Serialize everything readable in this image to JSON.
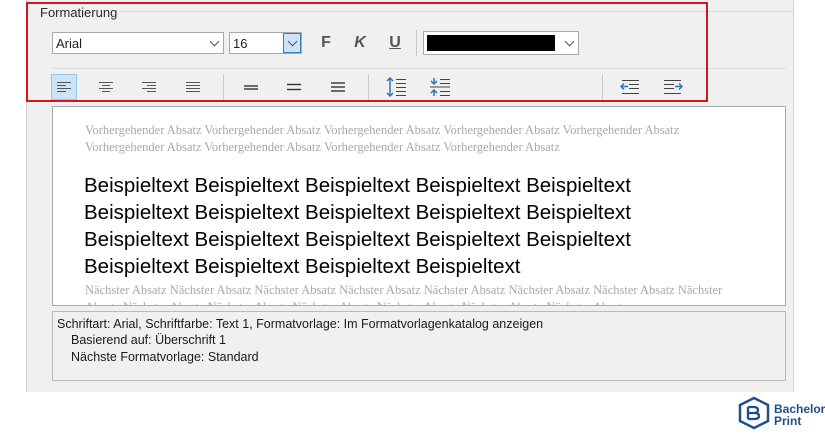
{
  "group": {
    "label": "Formatierung"
  },
  "font": {
    "name": "Arial",
    "size": "16"
  },
  "format_buttons": {
    "bold": "F",
    "italic": "K",
    "underline": "U"
  },
  "color": {
    "value": "#000000"
  },
  "preview": {
    "previous_paragraph": "Vorhergehender Absatz Vorhergehender Absatz Vorhergehender Absatz Vorhergehender Absatz Vorhergehender Absatz Vorhergehender Absatz Vorhergehender Absatz Vorhergehender Absatz Vorhergehender Absatz",
    "sample_lines": [
      "Beispieltext Beispieltext Beispieltext Beispieltext Beispieltext",
      "Beispieltext Beispieltext Beispieltext Beispieltext Beispieltext",
      "Beispieltext Beispieltext Beispieltext Beispieltext Beispieltext",
      "Beispieltext Beispieltext Beispieltext Beispieltext"
    ],
    "next_paragraph": "Nächster Absatz Nächster Absatz Nächster Absatz Nächster Absatz Nächster Absatz Nächster Absatz Nächster Absatz Nächster Absatz Nächster Absatz Nächster Absatz Nächster Absatz Nächster Absatz Nächster Absatz Nächster Absatz"
  },
  "description": {
    "line1": "Schriftart: Arial, Schriftfarbe: Text 1, Formatvorlage: Im Formatvorlagenkatalog anzeigen",
    "line2": "Basierend auf: Überschrift 1",
    "line3": "Nächste Formatvorlage: Standard"
  },
  "brand": {
    "line1": "Bachelor",
    "line2": "Print",
    "color": "#1f4e8c"
  },
  "colors": {
    "highlight": "#d8141c",
    "selected": "#cce4f7",
    "icon_blue": "#2e75b6"
  }
}
